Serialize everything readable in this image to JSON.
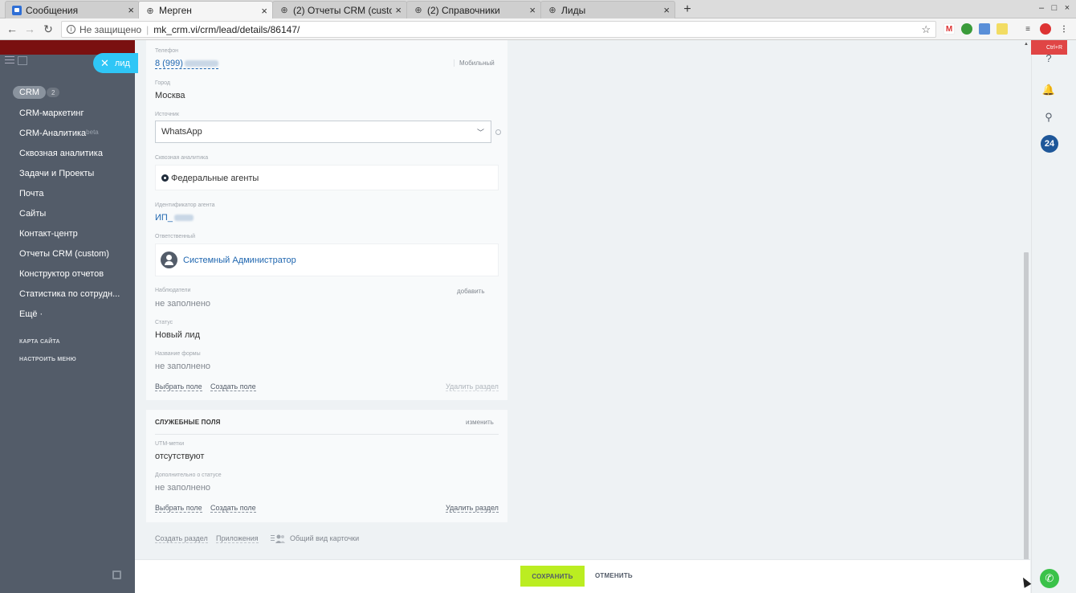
{
  "browser": {
    "tabs": [
      {
        "title": "Сообщения",
        "active": false
      },
      {
        "title": "Мерген",
        "active": true
      },
      {
        "title": "(2) Отчеты CRM (custo",
        "active": false
      },
      {
        "title": "(2) Справочники",
        "active": false
      },
      {
        "title": "Лиды",
        "active": false
      }
    ],
    "new_tab": "+",
    "address": {
      "security": "Не защищено",
      "url": "mk_crm.vi/crm/lead/details/86147/"
    }
  },
  "sidebar": {
    "lead_chip": "лид",
    "crm_label": "CRM",
    "crm_count": "2",
    "items": [
      {
        "label": "CRM-маркетинг"
      },
      {
        "label": "CRM-Аналитика",
        "badge": "beta"
      },
      {
        "label": "Сквозная аналитика"
      },
      {
        "label": "Задачи и Проекты"
      },
      {
        "label": "Почта"
      },
      {
        "label": "Сайты"
      },
      {
        "label": "Контакт-центр"
      },
      {
        "label": "Отчеты CRM (custom)"
      },
      {
        "label": "Конструктор отчетов"
      },
      {
        "label": "Статистика по сотрудн..."
      },
      {
        "label": "Ещё ·"
      }
    ],
    "sitemap": "КАРТА САЙТА",
    "configure_menu": "НАСТРОИТЬ МЕНЮ"
  },
  "lead_form": {
    "phone": {
      "label": "Телефон",
      "value": "8 (999)",
      "type": "Мобильный"
    },
    "city": {
      "label": "Город",
      "value": "Москва"
    },
    "source": {
      "label": "Источник",
      "value": "WhatsApp"
    },
    "analytics": {
      "label": "Сквозная аналитика",
      "value": "Федеральные агенты"
    },
    "agent_id": {
      "label": "Идентификатор агента",
      "value": "ИП_"
    },
    "responsible": {
      "label": "Ответственный",
      "value": "Системный Администратор"
    },
    "observers": {
      "label": "Наблюдатели",
      "value": "не заполнено",
      "add": "добавить"
    },
    "status": {
      "label": "Статус",
      "value": "Новый лид"
    },
    "form_name": {
      "label": "Название формы",
      "value": "не заполнено"
    },
    "select_field": "Выбрать поле",
    "create_field": "Создать поле",
    "delete_section": "Удалить раздел"
  },
  "service_section": {
    "title": "СЛУЖЕБНЫЕ ПОЛЯ",
    "edit": "изменить",
    "utm": {
      "label": "UTM-метки",
      "value": "отсутствуют"
    },
    "status_extra": {
      "label": "Дополнительно о статусе",
      "value": "не заполнено"
    },
    "select_field": "Выбрать поле",
    "create_field": "Создать поле",
    "delete_section": "Удалить раздел"
  },
  "footer_links": {
    "create_section": "Создать раздел",
    "apps": "Приложения",
    "card_view": "Общий вид карточки"
  },
  "actions": {
    "save": "СОХРАНИТЬ",
    "cancel": "ОТМЕНИТЬ"
  },
  "right_panel": {
    "hotkey": "Ctrl+R",
    "b24": "24"
  }
}
